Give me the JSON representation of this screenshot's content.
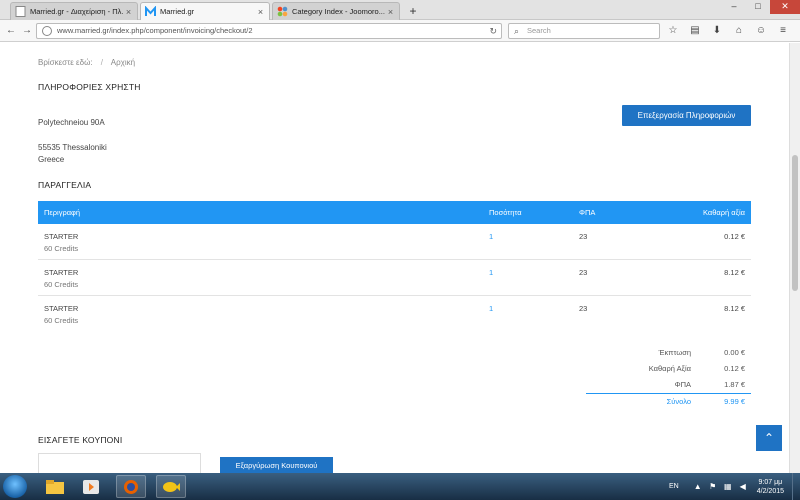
{
  "browser": {
    "tabs": [
      {
        "title": "Married.gr - Διαχείριση - Πλ...",
        "active": false
      },
      {
        "title": "Married.gr",
        "active": true
      },
      {
        "title": "Category Index - Joomoro...",
        "active": false
      }
    ],
    "new_tab": "+",
    "url": "www.married.gr/index.php/component/invoicing/checkout/2",
    "search_placeholder": "Search"
  },
  "breadcrumb": {
    "items": [
      "Βρίσκεστε εδώ:",
      "Αρχική"
    ],
    "separator": "/"
  },
  "user_info": {
    "heading": "ΠΛΗΡΟΦΟΡΙΕΣ ΧΡΗΣΤΗ",
    "edit_button": "Επεξεργασία Πληροφοριών",
    "address_line1": "Polytechneiou 90A",
    "address_line2": "55535 Thessaloniki",
    "country": "Greece"
  },
  "order": {
    "heading": "ΠΑΡΑΓΓΕΛΙΑ",
    "columns": {
      "description": "Περιγραφή",
      "quantity": "Ποσότητα",
      "vat": "ΦΠΑ",
      "net": "Καθαρή αξία"
    },
    "rows": [
      {
        "name": "STARTER",
        "sub": "60 Credits",
        "qty": "1",
        "vat": "23",
        "net": "0.12 €"
      },
      {
        "name": "STARTER",
        "sub": "60 Credits",
        "qty": "1",
        "vat": "23",
        "net": "8.12 €"
      },
      {
        "name": "STARTER",
        "sub": "60 Credits",
        "qty": "1",
        "vat": "23",
        "net": "8.12 €"
      }
    ]
  },
  "totals": {
    "discount_label": "Έκπτωση",
    "discount_value": "0.00 €",
    "net_label": "Καθαρή Αξία",
    "net_value": "0.12 €",
    "vat_label": "ΦΠΑ",
    "vat_value": "1.87 €",
    "total_label": "Σύνολο",
    "total_value": "9.99 €"
  },
  "coupon": {
    "heading": "ΕΙΣΑΓΕΤΕ ΚΟΥΠΟΝΙ",
    "button": "Εξαργύρωση Κουπονιού"
  },
  "taskbar": {
    "language": "EN",
    "time": "9:07 μμ",
    "date": "4/2/2015"
  },
  "colors": {
    "accent": "#2196f3",
    "button": "#1f73c4",
    "taskbar": "#1c3a56"
  }
}
